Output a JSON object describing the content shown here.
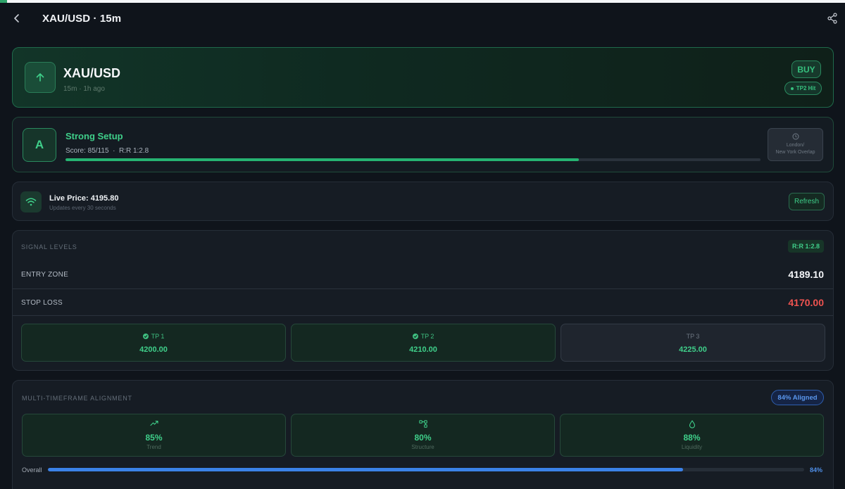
{
  "header": {
    "title": "XAU/USD · 15m"
  },
  "pair": {
    "symbol": "XAU/USD",
    "meta": "15m · 1h ago",
    "direction": "BUY",
    "status": "TP2 Hit"
  },
  "setup": {
    "grade": "A",
    "title": "Strong Setup",
    "score_line": "Score: 85/115  ·  R:R 1:2.8",
    "score_fraction": 0.739,
    "session": "London/\nNew York Overlap"
  },
  "live": {
    "label": "Live Price: 4195.80",
    "sub": "Updates every 30 seconds",
    "refresh_label": "Refresh"
  },
  "levels": {
    "title": "SIGNAL LEVELS",
    "rr": "R:R 1:2.8",
    "entry_label": "ENTRY ZONE",
    "entry_value": "4189.10",
    "stop_label": "STOP LOSS",
    "stop_value": "4170.00",
    "targets": [
      {
        "label": "TP 1",
        "value": "4200.00",
        "hit": true
      },
      {
        "label": "TP 2",
        "value": "4210.00",
        "hit": true
      },
      {
        "label": "TP 3",
        "value": "4225.00",
        "hit": false
      }
    ]
  },
  "mtf": {
    "title": "MULTI-TIMEFRAME ALIGNMENT",
    "aligned": "84% Aligned",
    "items": [
      {
        "pct": "85%",
        "name": "Trend",
        "icon": "trend-icon"
      },
      {
        "pct": "80%",
        "name": "Structure",
        "icon": "structure-icon"
      },
      {
        "pct": "88%",
        "name": "Liquidity",
        "icon": "droplet-icon"
      }
    ],
    "overall_label": "Overall",
    "overall_pct": "84%",
    "overall_fraction": 0.84
  },
  "colors": {
    "accent_green": "#3fcf8a",
    "stop_red": "#ef5350",
    "accent_blue": "#3b82e8"
  }
}
